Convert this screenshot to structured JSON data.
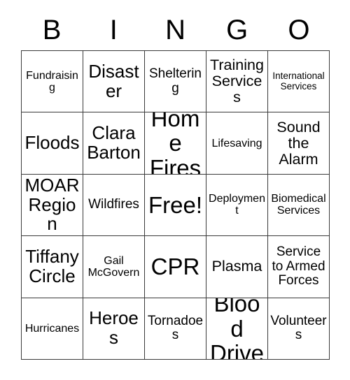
{
  "card": {
    "header_letters": [
      "B",
      "I",
      "N",
      "G",
      "O"
    ],
    "columns": 5,
    "rows": 5,
    "background_color": "#ffffff",
    "border_color": "#3a3a3a",
    "text_color": "#000000",
    "free_space": "Free!",
    "cells": [
      [
        {
          "label": "Fundraising",
          "size": "s"
        },
        {
          "label": "Disaster",
          "size": "xl"
        },
        {
          "label": "Sheltering",
          "size": "m"
        },
        {
          "label": "Training Services",
          "size": "l"
        },
        {
          "label": "International Services",
          "size": "xs"
        }
      ],
      [
        {
          "label": "Floods",
          "size": "xl"
        },
        {
          "label": "Clara Barton",
          "size": "xl"
        },
        {
          "label": "Home Fires",
          "size": "xxl"
        },
        {
          "label": "Lifesaving",
          "size": "s"
        },
        {
          "label": "Sound the Alarm",
          "size": "l"
        }
      ],
      [
        {
          "label": "MOAR Region",
          "size": "xl"
        },
        {
          "label": "Wildfires",
          "size": "m"
        },
        {
          "label": "Free!",
          "size": "xxl"
        },
        {
          "label": "Deployment",
          "size": "s"
        },
        {
          "label": "Biomedical Services",
          "size": "s"
        }
      ],
      [
        {
          "label": "Tiffany Circle",
          "size": "xl"
        },
        {
          "label": "Gail McGovern",
          "size": "s"
        },
        {
          "label": "CPR",
          "size": "xxl"
        },
        {
          "label": "Plasma",
          "size": "l"
        },
        {
          "label": "Service to Armed Forces",
          "size": "m"
        }
      ],
      [
        {
          "label": "Hurricanes",
          "size": "s"
        },
        {
          "label": "Heroes",
          "size": "xl"
        },
        {
          "label": "Tornadoes",
          "size": "m"
        },
        {
          "label": "Blood Drive",
          "size": "xxl"
        },
        {
          "label": "Volunteers",
          "size": "m"
        }
      ]
    ]
  }
}
